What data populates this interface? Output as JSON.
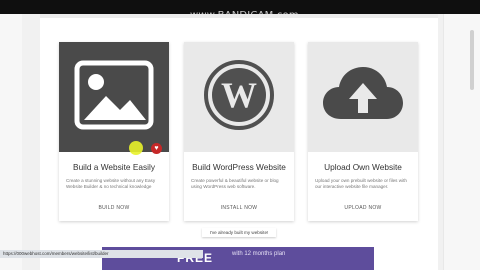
{
  "watermark": "www.BANDICAM.com",
  "cards": [
    {
      "title": "Build a Website Easily",
      "desc": "Create a stunning website without any Easy Website Builder & no technical knowledge",
      "button": "BUILD NOW",
      "icon": "image-icon",
      "image_bg": "#4a4a4a",
      "fav_icon": "♥"
    },
    {
      "title": "Build WordPress Website",
      "desc": "Create powerful & beautiful website or blog using WordPress web software.",
      "button": "INSTALL NOW",
      "icon": "wordpress-icon",
      "image_bg": "#e9e9e9"
    },
    {
      "title": "Upload Own Website",
      "desc": "Upload your own prebuilt website or files with our interactive website file manager.",
      "button": "UPLOAD NOW",
      "icon": "cloud-upload-icon",
      "image_bg": "#e9e9e9"
    }
  ],
  "already_link": "I've already built my website!",
  "promo": {
    "free": "FREE",
    "text": "with 12 months plan"
  },
  "statusbar": "https://000webhost.com/members/website/list/builder"
}
